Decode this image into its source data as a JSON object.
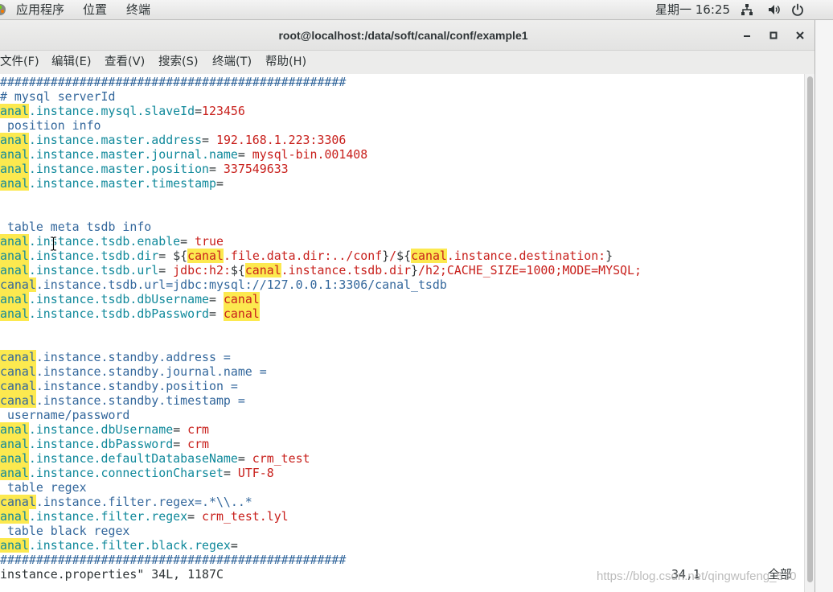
{
  "top_panel": {
    "app_icon": "gnome-applications-icon",
    "menus": {
      "applications": "应用程序",
      "places": "位置",
      "terminal": "终端"
    },
    "clock": "星期一 16:25",
    "network_icon": "network-wired-icon",
    "volume_icon": "volume-icon",
    "power_icon": "power-icon"
  },
  "window": {
    "title": "root@localhost:/data/soft/canal/conf/example1",
    "minimize_icon": "minimize-icon",
    "maximize_icon": "maximize-icon",
    "close_icon": "close-icon",
    "menu": [
      "文件(F)",
      "编辑(E)",
      "查看(V)",
      "搜索(S)",
      "终端(T)",
      "帮助(H)"
    ]
  },
  "pointer_icon": "ibeam-cursor-icon",
  "terminal": {
    "lines": [
      [
        {
          "t": "################################################",
          "fg": "#33679c"
        }
      ],
      [
        {
          "t": "# mysql serverId",
          "fg": "#33679c"
        }
      ],
      [
        {
          "t": "anal",
          "fg": "#10899b",
          "bg": "#fce94f"
        },
        {
          "t": ".instance.mysql.slaveId",
          "fg": "#10899b"
        },
        {
          "t": "=",
          "fg": "#2e3436"
        },
        {
          "t": "123456",
          "fg": "#c8201c"
        }
      ],
      [
        {
          "t": " position info",
          "fg": "#33679c"
        }
      ],
      [
        {
          "t": "anal",
          "fg": "#10899b",
          "bg": "#fce94f"
        },
        {
          "t": ".instance.master.address",
          "fg": "#10899b"
        },
        {
          "t": "=",
          "fg": "#2e3436"
        },
        {
          "t": " 192.168.1.223:3306",
          "fg": "#c8201c"
        }
      ],
      [
        {
          "t": "anal",
          "fg": "#10899b",
          "bg": "#fce94f"
        },
        {
          "t": ".instance.master.journal.name",
          "fg": "#10899b"
        },
        {
          "t": "=",
          "fg": "#2e3436"
        },
        {
          "t": " mysql-bin.001408",
          "fg": "#c8201c"
        }
      ],
      [
        {
          "t": "anal",
          "fg": "#10899b",
          "bg": "#fce94f"
        },
        {
          "t": ".instance.master.position",
          "fg": "#10899b"
        },
        {
          "t": "=",
          "fg": "#2e3436"
        },
        {
          "t": " 337549633",
          "fg": "#c8201c"
        }
      ],
      [
        {
          "t": "anal",
          "fg": "#10899b",
          "bg": "#fce94f"
        },
        {
          "t": ".instance.master.timestamp",
          "fg": "#10899b"
        },
        {
          "t": "=",
          "fg": "#2e3436"
        }
      ],
      [],
      [],
      [
        {
          "t": " table meta tsdb info",
          "fg": "#33679c"
        }
      ],
      [
        {
          "t": "anal",
          "fg": "#10899b",
          "bg": "#fce94f"
        },
        {
          "t": ".instance.tsdb.enable",
          "fg": "#10899b"
        },
        {
          "t": "=",
          "fg": "#2e3436"
        },
        {
          "t": " true",
          "fg": "#c8201c"
        }
      ],
      [
        {
          "t": "anal",
          "fg": "#10899b",
          "bg": "#fce94f"
        },
        {
          "t": ".instance.tsdb.dir",
          "fg": "#10899b"
        },
        {
          "t": "= ",
          "fg": "#2e3436"
        },
        {
          "t": "${",
          "fg": "#2e3436"
        },
        {
          "t": "canal",
          "fg": "#c8201c",
          "bg": "#fce94f"
        },
        {
          "t": ".file.data.dir:../conf",
          "fg": "#c8201c"
        },
        {
          "t": "}",
          "fg": "#2e3436"
        },
        {
          "t": "/",
          "fg": "#c8201c"
        },
        {
          "t": "${",
          "fg": "#2e3436"
        },
        {
          "t": "canal",
          "fg": "#c8201c",
          "bg": "#fce94f"
        },
        {
          "t": ".instance.destination:",
          "fg": "#c8201c"
        },
        {
          "t": "}",
          "fg": "#2e3436"
        }
      ],
      [
        {
          "t": "anal",
          "fg": "#10899b",
          "bg": "#fce94f"
        },
        {
          "t": ".instance.tsdb.url",
          "fg": "#10899b"
        },
        {
          "t": "=",
          "fg": "#2e3436"
        },
        {
          "t": " jdbc:h2:",
          "fg": "#c8201c"
        },
        {
          "t": "${",
          "fg": "#2e3436"
        },
        {
          "t": "canal",
          "fg": "#c8201c",
          "bg": "#fce94f"
        },
        {
          "t": ".instance.tsdb.dir",
          "fg": "#c8201c"
        },
        {
          "t": "}",
          "fg": "#2e3436"
        },
        {
          "t": "/h2;CACHE_SIZE=1000;MODE=MYSQL;",
          "fg": "#c8201c"
        }
      ],
      [
        {
          "t": "canal",
          "fg": "#33679c",
          "bg": "#fce94f"
        },
        {
          "t": ".instance.tsdb.url=jdbc:mysql://127.0.0.1:3306/canal_tsdb",
          "fg": "#33679c"
        }
      ],
      [
        {
          "t": "anal",
          "fg": "#10899b",
          "bg": "#fce94f"
        },
        {
          "t": ".instance.tsdb.dbUsername",
          "fg": "#10899b"
        },
        {
          "t": "= ",
          "fg": "#2e3436"
        },
        {
          "t": "canal",
          "fg": "#c8201c",
          "bg": "#fce94f"
        }
      ],
      [
        {
          "t": "anal",
          "fg": "#10899b",
          "bg": "#fce94f"
        },
        {
          "t": ".instance.tsdb.dbPassword",
          "fg": "#10899b"
        },
        {
          "t": "= ",
          "fg": "#2e3436"
        },
        {
          "t": "canal",
          "fg": "#c8201c",
          "bg": "#fce94f"
        }
      ],
      [],
      [],
      [
        {
          "t": "canal",
          "fg": "#33679c",
          "bg": "#fce94f"
        },
        {
          "t": ".instance.standby.address =",
          "fg": "#33679c"
        }
      ],
      [
        {
          "t": "canal",
          "fg": "#33679c",
          "bg": "#fce94f"
        },
        {
          "t": ".instance.standby.journal.name =",
          "fg": "#33679c"
        }
      ],
      [
        {
          "t": "canal",
          "fg": "#33679c",
          "bg": "#fce94f"
        },
        {
          "t": ".instance.standby.position =",
          "fg": "#33679c"
        }
      ],
      [
        {
          "t": "canal",
          "fg": "#33679c",
          "bg": "#fce94f"
        },
        {
          "t": ".instance.standby.timestamp =",
          "fg": "#33679c"
        }
      ],
      [
        {
          "t": " username/password",
          "fg": "#33679c"
        }
      ],
      [
        {
          "t": "anal",
          "fg": "#10899b",
          "bg": "#fce94f"
        },
        {
          "t": ".instance.dbUsername",
          "fg": "#10899b"
        },
        {
          "t": "=",
          "fg": "#2e3436"
        },
        {
          "t": " crm",
          "fg": "#c8201c"
        }
      ],
      [
        {
          "t": "anal",
          "fg": "#10899b",
          "bg": "#fce94f"
        },
        {
          "t": ".instance.dbPassword",
          "fg": "#10899b"
        },
        {
          "t": "=",
          "fg": "#2e3436"
        },
        {
          "t": " crm",
          "fg": "#c8201c"
        }
      ],
      [
        {
          "t": "anal",
          "fg": "#10899b",
          "bg": "#fce94f"
        },
        {
          "t": ".instance.defaultDatabaseName",
          "fg": "#10899b"
        },
        {
          "t": "=",
          "fg": "#2e3436"
        },
        {
          "t": " crm_test",
          "fg": "#c8201c"
        }
      ],
      [
        {
          "t": "anal",
          "fg": "#10899b",
          "bg": "#fce94f"
        },
        {
          "t": ".instance.connectionCharset",
          "fg": "#10899b"
        },
        {
          "t": "=",
          "fg": "#2e3436"
        },
        {
          "t": " UTF-8",
          "fg": "#c8201c"
        }
      ],
      [
        {
          "t": " table regex",
          "fg": "#33679c"
        }
      ],
      [
        {
          "t": "canal",
          "fg": "#33679c",
          "bg": "#fce94f"
        },
        {
          "t": ".instance.filter.regex=.*\\\\..*",
          "fg": "#33679c"
        }
      ],
      [
        {
          "t": "anal",
          "fg": "#10899b",
          "bg": "#fce94f"
        },
        {
          "t": ".instance.filter.regex",
          "fg": "#10899b"
        },
        {
          "t": "=",
          "fg": "#2e3436"
        },
        {
          "t": " crm_test.lyl",
          "fg": "#c8201c"
        }
      ],
      [
        {
          "t": " table black regex",
          "fg": "#33679c"
        }
      ],
      [
        {
          "t": "anal",
          "fg": "#10899b",
          "bg": "#fce94f"
        },
        {
          "t": ".instance.filter.black.regex",
          "fg": "#10899b"
        },
        {
          "t": "=",
          "fg": "#2e3436"
        }
      ],
      [
        {
          "t": "################################################",
          "fg": "#33679c"
        }
      ]
    ],
    "status": {
      "message": "instance.properties\" 34L, 1187C",
      "position": "34,1",
      "scope": "全部"
    }
  },
  "watermark": "https://blog.csdn.net/qingwufeng_530"
}
